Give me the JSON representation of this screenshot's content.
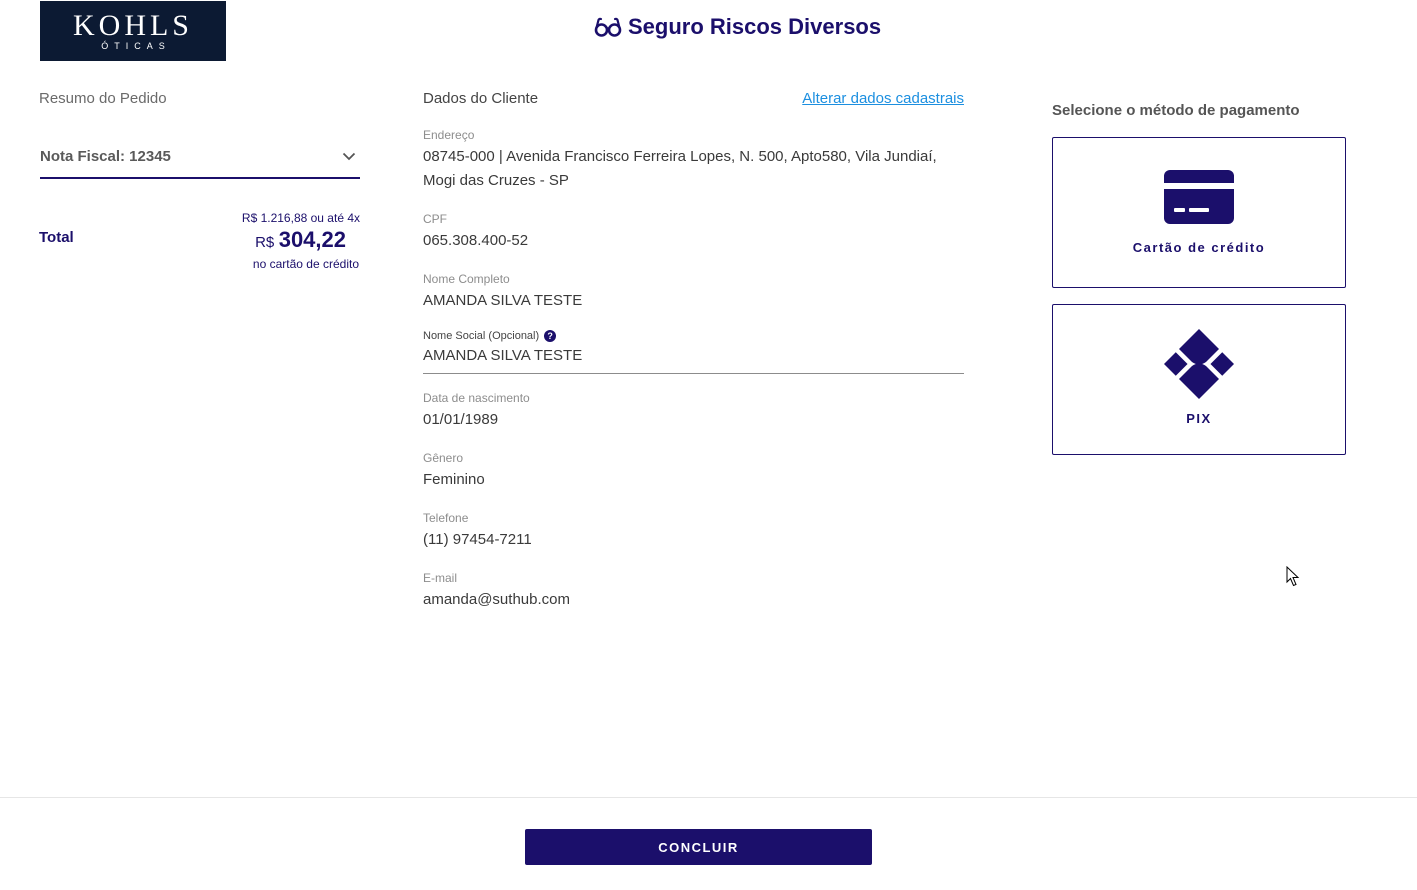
{
  "logo": {
    "brand": "KOHLS",
    "sub": "ÓTICAS"
  },
  "page": {
    "title": "Seguro Riscos Diversos"
  },
  "summary": {
    "heading": "Resumo do Pedido",
    "invoice_label": "Nota Fiscal: 12345",
    "total_label": "Total",
    "price_line1": "R$ 1.216,88 ou até 4x",
    "currency": "R$",
    "installment_amount": "304,22",
    "price_line3": "no cartão de crédito"
  },
  "client": {
    "heading": "Dados do Cliente",
    "alter_link": "Alterar dados cadastrais",
    "address_label": "Endereço",
    "address_value": "08745-000 | Avenida Francisco Ferreira Lopes, N. 500, Apto580, Vila Jundiaí, Mogi das Cruzes - SP",
    "cpf_label": "CPF",
    "cpf_value": "065.308.400-52",
    "name_label": "Nome Completo",
    "name_value": "AMANDA SILVA TESTE",
    "social_label": "Nome Social (Opcional)",
    "social_value": "AMANDA SILVA TESTE",
    "birth_label": "Data de nascimento",
    "birth_value": "01/01/1989",
    "gender_label": "Gênero",
    "gender_value": "Feminino",
    "phone_label": "Telefone",
    "phone_value": "(11) 97454-7211",
    "email_label": "E-mail",
    "email_value": "amanda@suthub.com"
  },
  "payment": {
    "heading": "Selecione o método de pagamento",
    "credit_card_label": "Cartão de crédito",
    "pix_label": "PIX"
  },
  "footer": {
    "conclude_label": "CONCLUIR"
  },
  "colors": {
    "primary": "#1b0f6b",
    "link": "#1c8fe0",
    "logo_bg": "#0c1a33"
  }
}
